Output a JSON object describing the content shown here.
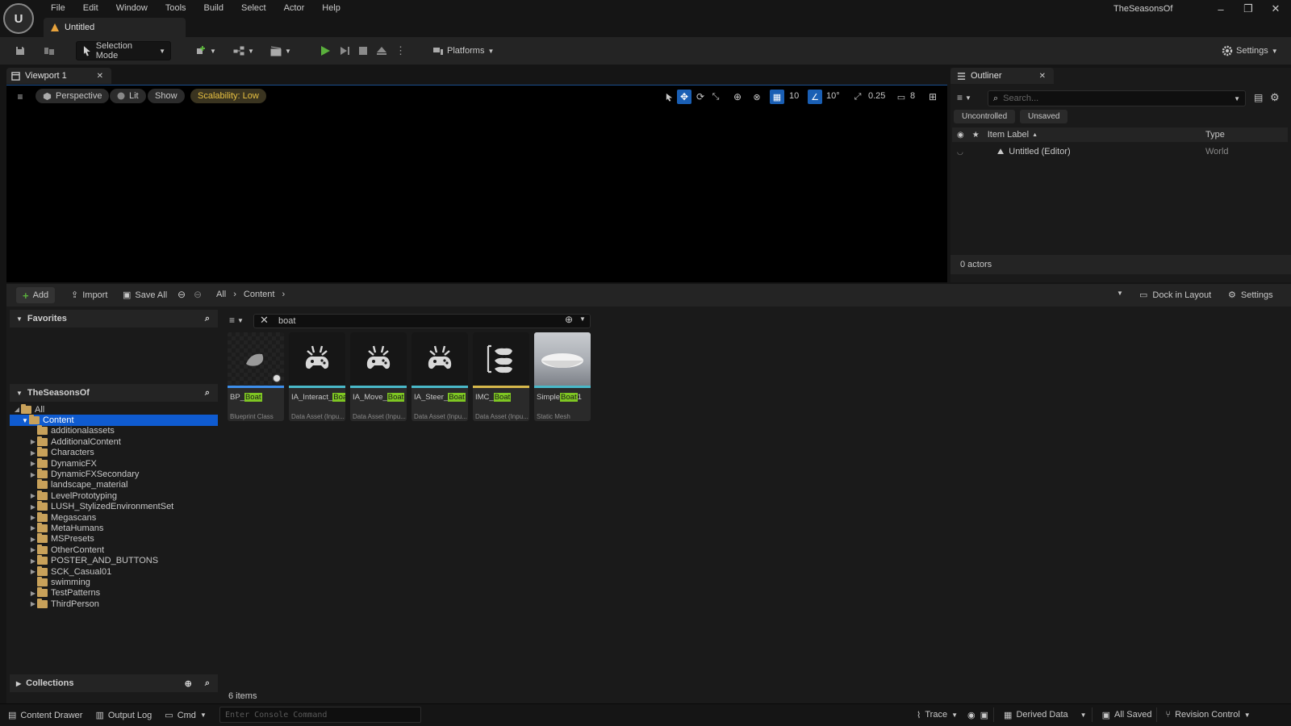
{
  "app": {
    "menu": [
      "File",
      "Edit",
      "Window",
      "Tools",
      "Build",
      "Select",
      "Actor",
      "Help"
    ],
    "level_tab": "Untitled",
    "project_name": "TheSeasonsOf"
  },
  "toolbar": {
    "selection_mode": "Selection Mode",
    "platforms": "Platforms",
    "settings": "Settings"
  },
  "viewport": {
    "tab_label": "Viewport 1",
    "perspective": "Perspective",
    "lit": "Lit",
    "show": "Show",
    "scalability": "Scalability: Low",
    "grid_snap": "10",
    "rotation_snap": "10°",
    "scale_snap": "0.25",
    "camera_speed": "8"
  },
  "outliner": {
    "tab_label": "Outliner",
    "search_placeholder": "Search...",
    "chips": [
      "Uncontrolled",
      "Unsaved"
    ],
    "col_label": "Item Label",
    "col_type": "Type",
    "rows": [
      {
        "label": "Untitled (Editor)",
        "type": "World"
      }
    ],
    "footer": "0 actors"
  },
  "content_browser": {
    "add": "Add",
    "import": "Import",
    "save_all": "Save All",
    "breadcrumb": [
      "All",
      "Content"
    ],
    "dock_in_layout": "Dock in Layout",
    "settings": "Settings",
    "favorites": "Favorites",
    "project_section": "TheSeasonsOf",
    "collections": "Collections",
    "search_value": "boat",
    "item_count": "6 items",
    "tree": {
      "all": "All",
      "content": "Content",
      "folders": [
        {
          "name": "additionalassets",
          "expandable": false
        },
        {
          "name": "AdditionalContent",
          "expandable": true
        },
        {
          "name": "Characters",
          "expandable": true
        },
        {
          "name": "DynamicFX",
          "expandable": true
        },
        {
          "name": "DynamicFXSecondary",
          "expandable": true
        },
        {
          "name": "landscape_material",
          "expandable": false
        },
        {
          "name": "LevelPrototyping",
          "expandable": true
        },
        {
          "name": "LUSH_StylizedEnvironmentSet",
          "expandable": true
        },
        {
          "name": "Megascans",
          "expandable": true
        },
        {
          "name": "MetaHumans",
          "expandable": true
        },
        {
          "name": "MSPresets",
          "expandable": true
        },
        {
          "name": "OtherContent",
          "expandable": true
        },
        {
          "name": "POSTER_AND_BUTTONS",
          "expandable": true
        },
        {
          "name": "SCK_Casual01",
          "expandable": true
        },
        {
          "name": "swimming",
          "expandable": false
        },
        {
          "name": "TestPatterns",
          "expandable": true
        },
        {
          "name": "ThirdPerson",
          "expandable": true
        }
      ]
    },
    "assets": [
      {
        "prefix": "BP_",
        "match": "Boat",
        "suffix": "",
        "class": "Blueprint Class",
        "bar": "#3d8eea",
        "icon": "blueprint-icon"
      },
      {
        "prefix": "IA_Interact_",
        "match": "Boat",
        "suffix": "",
        "class": "Data Asset (Inpu...",
        "bar": "#49b8c8",
        "icon": "gamepad-icon"
      },
      {
        "prefix": "IA_Move_",
        "match": "Boat",
        "suffix": "",
        "class": "Data Asset (Inpu...",
        "bar": "#49b8c8",
        "icon": "gamepad-icon"
      },
      {
        "prefix": "IA_Steer_",
        "match": "Boat",
        "suffix": "",
        "class": "Data Asset (Inpu...",
        "bar": "#49b8c8",
        "icon": "gamepad-icon"
      },
      {
        "prefix": "IMC_",
        "match": "Boat",
        "suffix": "",
        "class": "Data Asset (Inpu...",
        "bar": "#d6b84b",
        "icon": "mapping-context-icon"
      },
      {
        "prefix": "Simple",
        "match": "Boat",
        "suffix": "1",
        "class": "Static Mesh",
        "bar": "#49b8c8",
        "icon": "mesh-icon"
      }
    ]
  },
  "statusbar": {
    "content_drawer": "Content Drawer",
    "output_log": "Output Log",
    "cmd": "Cmd",
    "console_placeholder": "Enter Console Command",
    "trace": "Trace",
    "derived_data": "Derived Data",
    "all_saved": "All Saved",
    "revision_control": "Revision Control"
  }
}
